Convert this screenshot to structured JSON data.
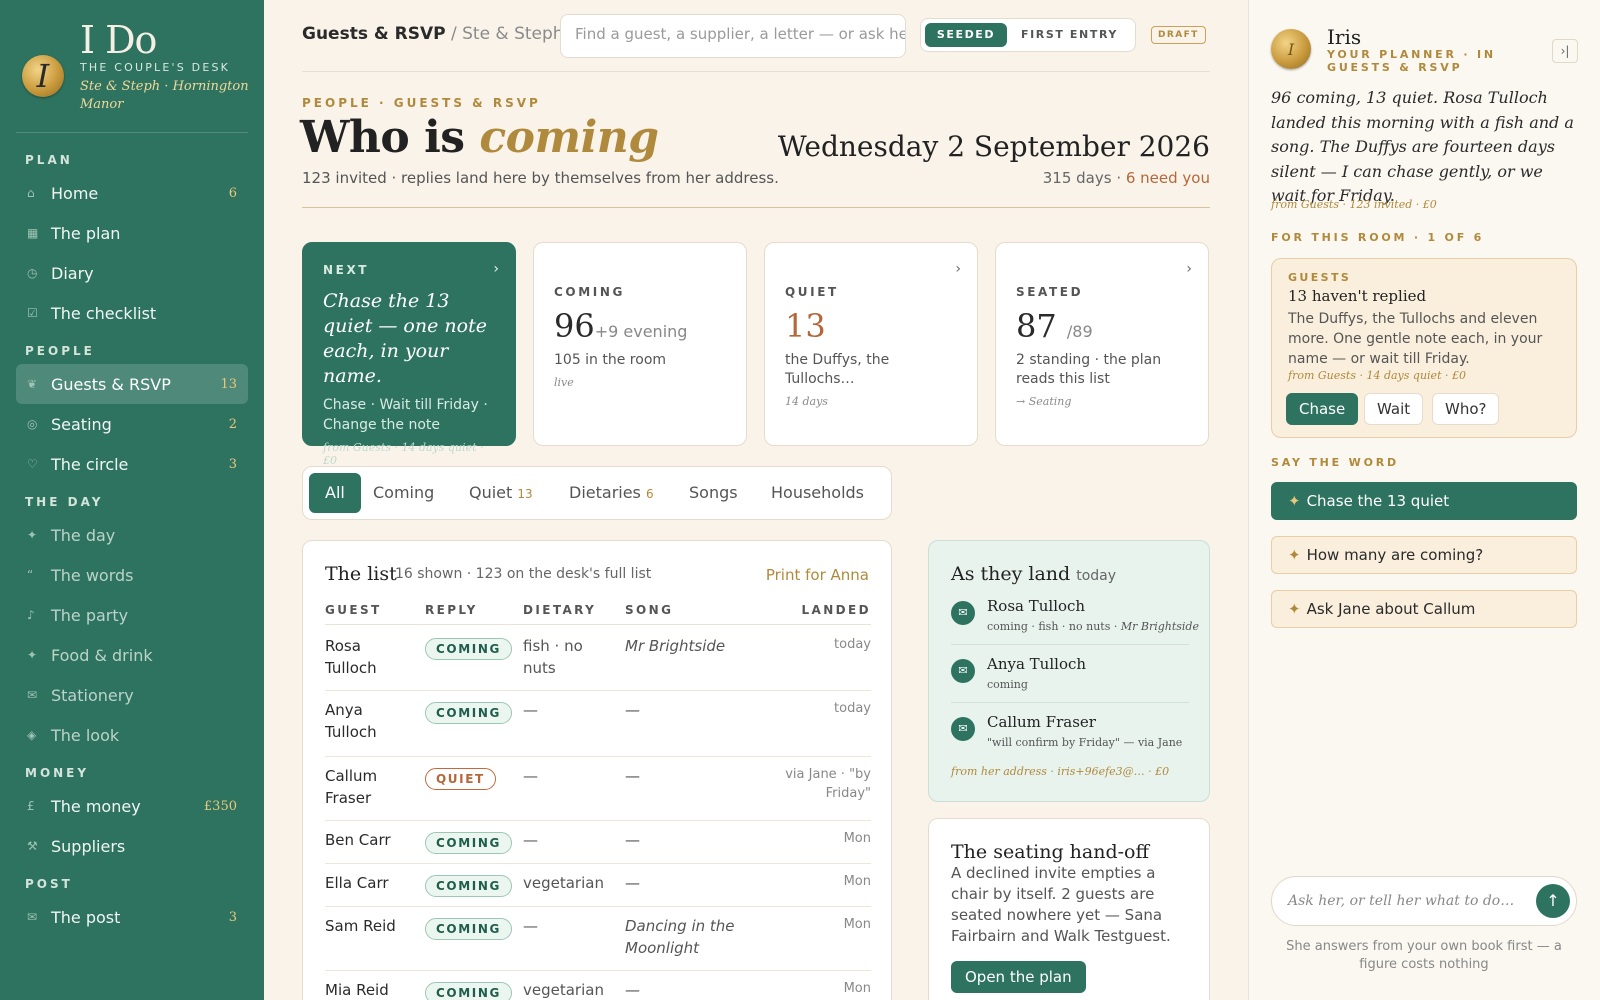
{
  "brand": {
    "logo": "I Do",
    "subtitle": "THE COUPLE'S DESK",
    "couple": "Ste & Steph · Hornington Manor",
    "seal_letter": "I"
  },
  "sidebar": {
    "sections": [
      {
        "label": "PLAN",
        "items": [
          {
            "label": "Home",
            "icon": "house-icon",
            "count": "6"
          },
          {
            "label": "The plan",
            "icon": "grid-icon",
            "count": ""
          },
          {
            "label": "Diary",
            "icon": "clock-icon",
            "count": ""
          },
          {
            "label": "The checklist",
            "icon": "checkbox-icon",
            "count": ""
          }
        ]
      },
      {
        "label": "PEOPLE",
        "items": [
          {
            "label": "Guests & RSVP",
            "icon": "people-icon",
            "count": "13",
            "active": true
          },
          {
            "label": "Seating",
            "icon": "circle-target-icon",
            "count": "2"
          },
          {
            "label": "The circle",
            "icon": "heart-icon",
            "count": "3"
          }
        ]
      },
      {
        "label": "THE DAY",
        "items": [
          {
            "label": "The day",
            "icon": "sparkle-icon",
            "count": ""
          },
          {
            "label": "The words",
            "icon": "quote-icon",
            "count": ""
          },
          {
            "label": "The party",
            "icon": "music-note-icon",
            "count": ""
          },
          {
            "label": "Food & drink",
            "icon": "sparkle-icon",
            "count": ""
          },
          {
            "label": "Stationery",
            "icon": "envelope-icon",
            "count": ""
          },
          {
            "label": "The look",
            "icon": "diamond-icon",
            "count": ""
          }
        ]
      },
      {
        "label": "MONEY",
        "items": [
          {
            "label": "The money",
            "icon": "pound-icon",
            "count": "£350"
          },
          {
            "label": "Suppliers",
            "icon": "tools-icon",
            "count": ""
          }
        ]
      },
      {
        "label": "POST",
        "items": [
          {
            "label": "The post",
            "icon": "envelope-icon",
            "count": "3"
          }
        ]
      }
    ]
  },
  "topbar": {
    "crumb_main": "Guests & RSVP",
    "crumb_sep": " / ",
    "crumb_sub": "Ste & Steph",
    "search_placeholder": "Find a guest, a supplier, a letter — or ask her…",
    "toggle_on": "SEEDED",
    "toggle_off": "FIRST ENTRY",
    "draft": "DRAFT"
  },
  "header": {
    "eyebrow": "PEOPLE · GUESTS & RSVP",
    "title_plain": "Who is ",
    "title_em": "coming",
    "subtitle": "123 invited · replies land here by themselves from her address.",
    "date": "Wednesday 2 September 2026",
    "days": "315 days · ",
    "need": "6 need you"
  },
  "cards": {
    "next": {
      "label": "NEXT",
      "title": "Chase the 13 quiet — one note each, in your name.",
      "actions": "Chase · Wait till Friday · Change the note",
      "foot": "from Guests · 14 days quiet · £0"
    },
    "coming": {
      "label": "COMING",
      "value": "96",
      "extra": "+9 evening",
      "desc": "105 in the room",
      "foot": "live"
    },
    "quiet": {
      "label": "QUIET",
      "value": "13",
      "desc": "the Duffys, the Tullochs…",
      "foot": "14 days"
    },
    "seated": {
      "label": "SEATED",
      "value": "87",
      "extra": "/89",
      "desc": "2 standing · the plan reads this list",
      "foot": "→ Seating"
    }
  },
  "filters": [
    {
      "label": "All",
      "count": "",
      "active": true
    },
    {
      "label": "Coming",
      "count": ""
    },
    {
      "label": "Quiet",
      "count": "13"
    },
    {
      "label": "Dietaries",
      "count": "6"
    },
    {
      "label": "Songs",
      "count": ""
    },
    {
      "label": "Households",
      "count": ""
    }
  ],
  "list": {
    "title": "The list",
    "subtitle": "16 shown · 123 on the desk's full list",
    "print": "Print for Anna",
    "columns": [
      "GUEST",
      "REPLY",
      "DIETARY",
      "SONG",
      "LANDED"
    ],
    "rows": [
      {
        "guest": "Rosa Tulloch",
        "reply": "COMING",
        "dietary": "fish · no nuts",
        "song": "Mr Brightside",
        "landed": "today"
      },
      {
        "guest": "Anya Tulloch",
        "reply": "COMING",
        "dietary": "—",
        "song": "—",
        "landed": "today"
      },
      {
        "guest": "Callum Fraser",
        "reply": "QUIET",
        "dietary": "—",
        "song": "—",
        "landed": "via Jane · \"by Friday\""
      },
      {
        "guest": "Ben Carr",
        "reply": "COMING",
        "dietary": "—",
        "song": "—",
        "landed": "Mon"
      },
      {
        "guest": "Ella Carr",
        "reply": "COMING",
        "dietary": "vegetarian",
        "song": "—",
        "landed": "Mon"
      },
      {
        "guest": "Sam Reid",
        "reply": "COMING",
        "dietary": "—",
        "song": "Dancing in the Moonlight",
        "landed": "Mon"
      },
      {
        "guest": "Mia Reid",
        "reply": "COMING",
        "dietary": "vegetarian",
        "song": "—",
        "landed": "Mon"
      }
    ]
  },
  "landing": {
    "title": "As they land",
    "when": "today",
    "items": [
      {
        "name": "Rosa Tulloch",
        "meta": "coming · fish · no nuts · ",
        "meta_em": "Mr Brightside"
      },
      {
        "name": "Anya Tulloch",
        "meta": "coming",
        "meta_em": ""
      },
      {
        "name": "Callum Fraser",
        "meta": "\"will confirm by Friday\" — via Jane",
        "meta_em": ""
      }
    ],
    "foot": "from her address · iris+96efe3@… · £0"
  },
  "seating": {
    "title": "The seating hand-off",
    "body": "A declined invite empties a chair by itself. 2 guests are seated nowhere yet — Sana Fairbairn and Walk Testguest.",
    "button": "Open the plan"
  },
  "panel": {
    "name": "Iris",
    "role": "YOUR PLANNER · IN GUESTS & RSVP",
    "message": "96 coming, 13 quiet. Rosa Tulloch landed this morning with a fish and a song. The Duffys are fourteen days silent — I can chase gently, or we wait for Friday.",
    "source": "from Guests · 123 invited · £0",
    "room_label": "FOR THIS ROOM · 1 OF 6",
    "card": {
      "label": "GUESTS",
      "title": "13 haven't replied",
      "body": "The Duffys, the Tullochs and eleven more. One gentle note each, in your name — or wait till Friday.",
      "source": "from Guests · 14 days quiet · £0",
      "buttons": [
        "Chase",
        "Wait",
        "Who?"
      ]
    },
    "say_label": "SAY THE WORD",
    "say": [
      "Chase the 13 quiet",
      "How many are coming?",
      "Ask Jane about Callum"
    ],
    "ask_placeholder": "Ask her, or tell her what to do…",
    "note": "She answers from your own book first — a figure costs nothing"
  },
  "colors": {
    "green": "#2d7360",
    "gold": "#b08a3c",
    "cream": "#faf3ea",
    "rust": "#b5673a"
  }
}
